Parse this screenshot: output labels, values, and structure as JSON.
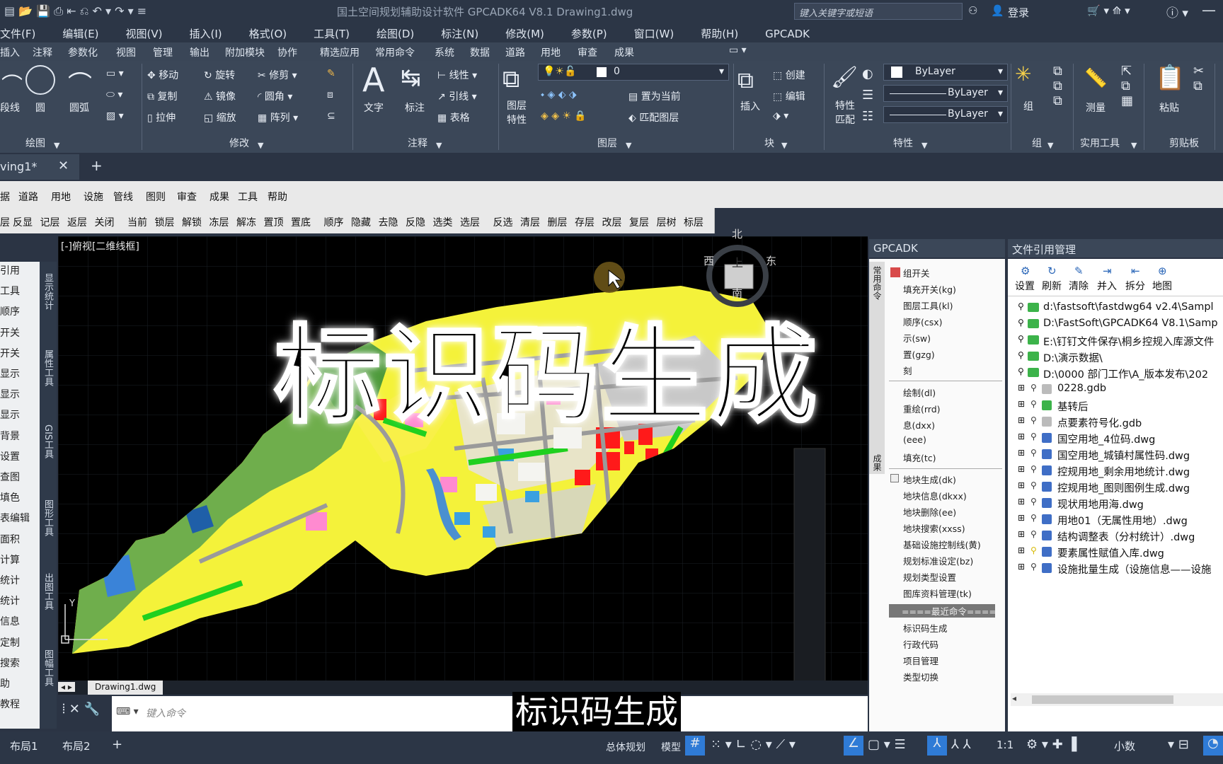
{
  "window": {
    "title": "国土空间规划辅助设计软件 GPCADK64 V8.1    Drawing1.dwg",
    "search_placeholder": "键入关键字或短语",
    "login": "登录"
  },
  "menu": [
    "文件(F)",
    "编辑(E)",
    "视图(V)",
    "插入(I)",
    "格式(O)",
    "工具(T)",
    "绘图(D)",
    "标注(N)",
    "修改(M)",
    "参数(P)",
    "窗口(W)",
    "帮助(H)",
    "GPCADK"
  ],
  "ribbon_tabs": [
    "插入",
    "注释",
    "参数化",
    "视图",
    "管理",
    "输出",
    "附加模块",
    "协作",
    "精选应用",
    "常用命令",
    "系统",
    "数据",
    "道路",
    "用地",
    "审查",
    "成果"
  ],
  "ribbon": {
    "draw": {
      "items": [
        "段线",
        "圆",
        "圆弧"
      ],
      "group": "绘图"
    },
    "modify": {
      "items": [
        "移动",
        "旋转",
        "修剪",
        "复制",
        "镜像",
        "圆角",
        "拉伸",
        "缩放",
        "阵列"
      ],
      "group": "修改"
    },
    "annot": {
      "items": [
        "文字",
        "标注",
        "线性",
        "引线",
        "表格"
      ],
      "group": "注释"
    },
    "layer": {
      "current": "0",
      "items": [
        "图层特性",
        "置为当前",
        "匹配图层"
      ],
      "group": "图层"
    },
    "block": {
      "items": [
        "插入",
        "创建",
        "编辑"
      ],
      "group": "块"
    },
    "props": {
      "match": "特性匹配",
      "v1": "ByLayer",
      "v2": "ByLayer",
      "v3": "ByLayer",
      "group": "特性"
    },
    "groups_g": {
      "label": "组",
      "group": "组"
    },
    "util": {
      "label": "测量",
      "group": "实用工具"
    },
    "clip": {
      "label": "粘贴",
      "group": "剪贴板"
    }
  },
  "doc_tab": "ving1*",
  "toolbar1": [
    "据",
    "道路",
    "用地",
    "设施",
    "管线",
    "图则",
    "审查",
    "成果",
    "工具",
    "帮助"
  ],
  "toolbar2": [
    "层",
    "反显",
    "记层",
    "返层",
    "关闭",
    "当前",
    "锁层",
    "解锁",
    "冻层",
    "解冻",
    "置顶",
    "置底",
    "顺序",
    "隐藏",
    "去隐",
    "反隐",
    "选类",
    "选层",
    "反选",
    "清层",
    "删层",
    "存层",
    "改层",
    "复层",
    "层树",
    "标层"
  ],
  "left_items": [
    "引用",
    "工具",
    "顺序",
    "开关",
    "开关",
    "显示",
    "显示",
    "显示",
    "背景",
    "设置",
    "查图",
    "填色",
    "表编辑",
    "面积",
    "计算",
    "统计",
    "统计",
    "信息",
    "定制",
    "搜索",
    "助",
    "教程"
  ],
  "left_vtabs": [
    "显示统计",
    "属性工具",
    "GIS工具",
    "图形工具",
    "出图工具",
    "图幅工具"
  ],
  "viewport": {
    "label": "[-]俯视[二维线框]",
    "compass": {
      "n": "北",
      "s": "南",
      "e": "东",
      "w": "西",
      "top": "上"
    },
    "axis_y": "Y"
  },
  "overlay_title": "标识码生成",
  "subtitle": "标识码生成",
  "file_tab": "Drawing1.dwg",
  "command_placeholder": "键入命令",
  "gp_panel": {
    "title": "GPCADK",
    "vtab": "常用命令",
    "vtab2": "成果",
    "items": [
      "组开关",
      "填充开关(kg)",
      "图层工具(kl)",
      "顺序(csx)",
      "示(sw)",
      "置(gzg)",
      "刻",
      "绘制(dl)",
      "重绘(rrd)",
      "息(dxx)",
      "(eee)",
      "填充(tc)",
      "地块生成(dk)",
      "地块信息(dkxx)",
      "地块删除(ee)",
      "地块搜索(xxss)",
      "基础设施控制线(黄)",
      "规划标准设定(bz)",
      "规划类型设置",
      "图库资料管理(tk)",
      "====最近命令====",
      "标识码生成",
      "行政代码",
      "项目管理",
      "类型切换"
    ]
  },
  "file_panel": {
    "title": "文件引用管理",
    "toolbar": [
      "设置",
      "刷新",
      "清除",
      "并入",
      "拆分",
      "地图"
    ],
    "folders": [
      "d:\\fastsoft\\fastdwg64 v2.4\\Sampl",
      "D:\\FastSoft\\GPCADK64 V8.1\\Samp",
      "E:\\钉钉文件保存\\桐乡控规入库源文件",
      "D:\\演示数据\\",
      "D:\\0000 部门工作\\A_版本发布\\202"
    ],
    "children": [
      "0228.gdb",
      "基转后",
      "点要素符号化.gdb",
      "国空用地_4位码.dwg",
      "国空用地_城镇村属性码.dwg",
      "控规用地_剩余用地统计.dwg",
      "控规用地_图则图例生成.dwg",
      "现状用地用海.dwg",
      "用地01（无属性用地）.dwg",
      "结构调整表（分村统计）.dwg",
      "要素属性赋值入库.dwg",
      "设施批量生成（设施信息——设施"
    ]
  },
  "status": {
    "layouts": [
      "布局1",
      "布局2"
    ],
    "plan": "总体规划",
    "model": "模型",
    "scale": "1:1",
    "units": "小数"
  },
  "colors": {
    "accent": "#2f7bd6",
    "bg": "#2b3444",
    "overlay_text": "#000000"
  }
}
